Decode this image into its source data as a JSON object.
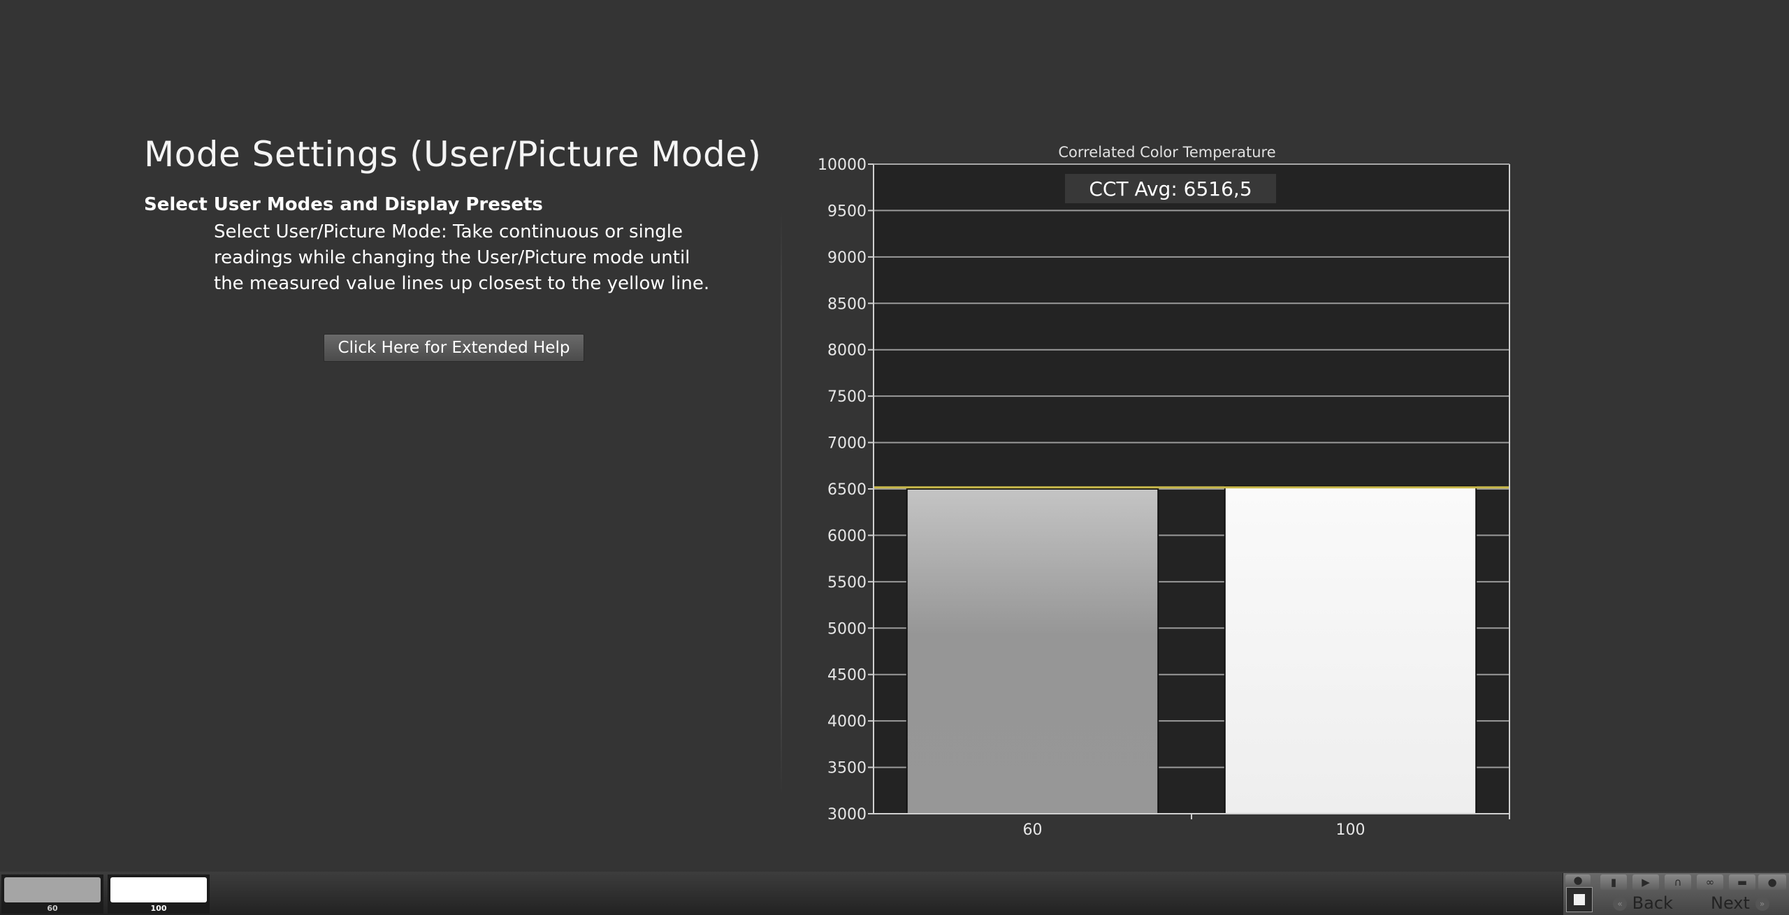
{
  "header": {
    "title": "Mode Settings (User/Picture Mode)",
    "section_heading": "Select User Modes and Display Presets",
    "instructions": "Select User/Picture Mode: Take continuous or single readings while changing the User/Picture mode until the measured value lines up closest to the yellow line.",
    "help_button_label": "Click Here for Extended Help"
  },
  "chart_data": {
    "type": "bar",
    "title": "Correlated Color Temperature",
    "annotation": "CCT Avg: 6516,5",
    "categories": [
      "60",
      "100"
    ],
    "values": [
      6500,
      6530
    ],
    "bar_colors": [
      "#a0a0a0",
      "#f3f3f3"
    ],
    "ylim": [
      3000,
      10000
    ],
    "yticks": [
      "3000",
      "3500",
      "4000",
      "4500",
      "5000",
      "5500",
      "6000",
      "6500",
      "7000",
      "7500",
      "8000",
      "8500",
      "9000",
      "9500",
      "10000"
    ],
    "target_line": 6516.5,
    "target_line_color": "#c8b84a",
    "grid": true
  },
  "bottom_bar": {
    "thumbnails": [
      {
        "label": "60",
        "color": "#a5a5a5"
      },
      {
        "label": "100",
        "color": "#ffffff"
      }
    ],
    "controls": {
      "icons": [
        "eye-icon",
        "delete-icon",
        "play-icon",
        "hold-icon",
        "loop-icon",
        "save-icon",
        "dark-icon"
      ],
      "back_label": "Back",
      "next_label": "Next"
    }
  }
}
